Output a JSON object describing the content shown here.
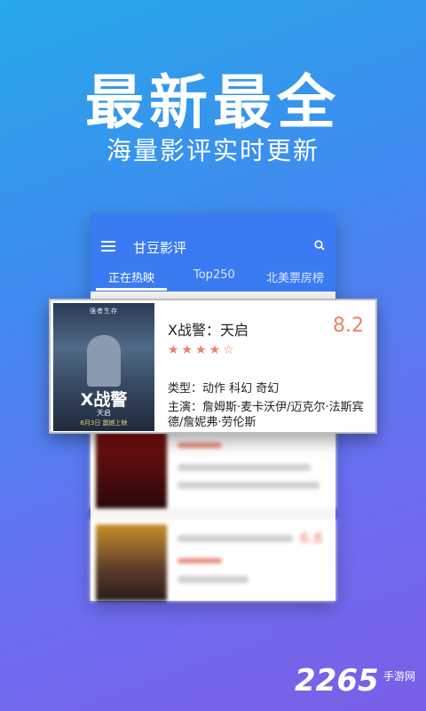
{
  "promo": {
    "headline": "最新最全",
    "subheadline": "海量影评实时更新"
  },
  "app": {
    "title": "甘豆影评",
    "tabs": [
      {
        "label": "正在热映",
        "active": true
      },
      {
        "label": "Top250",
        "active": false
      },
      {
        "label": "北美票房榜",
        "active": false
      }
    ],
    "accent_color": "#3a7bf2"
  },
  "featured_movie": {
    "poster_tagline": "强者生存",
    "poster_title": "X战警",
    "poster_subtitle": "天启",
    "poster_date": "6月3日 震撼上映",
    "title": "X战警：天启",
    "rating": "8.2",
    "stars": "★★★★☆",
    "genre": "类型：动作 科幻 奇幻",
    "cast": "主演：詹姆斯·麦卡沃伊/迈克尔·法斯宾德/詹妮弗·劳伦斯"
  },
  "blurred_list": [
    {
      "score": ""
    },
    {
      "score": "6.8"
    }
  ],
  "watermark": {
    "number": "2265",
    "site": "手游网"
  }
}
